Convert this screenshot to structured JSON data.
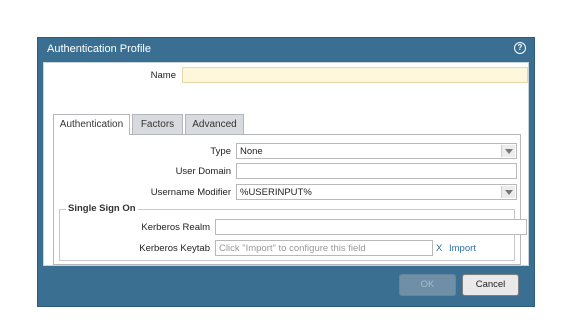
{
  "dialog": {
    "title": "Authentication Profile",
    "help_icon": "?"
  },
  "name_field": {
    "label": "Name",
    "value": ""
  },
  "tabs": [
    {
      "label": "Authentication",
      "active": true
    },
    {
      "label": "Factors",
      "active": false
    },
    {
      "label": "Advanced",
      "active": false
    }
  ],
  "authentication": {
    "type": {
      "label": "Type",
      "value": "None"
    },
    "user_domain": {
      "label": "User Domain",
      "value": ""
    },
    "username_modifier": {
      "label": "Username Modifier",
      "value": "%USERINPUT%"
    }
  },
  "sso": {
    "title": "Single Sign On",
    "kerberos_realm": {
      "label": "Kerberos Realm",
      "value": ""
    },
    "kerberos_keytab": {
      "label": "Kerberos Keytab",
      "placeholder": "Click \"Import\" to configure this field"
    },
    "clear_label": "X",
    "import_label": "Import"
  },
  "buttons": {
    "ok": "OK",
    "cancel": "Cancel"
  },
  "colors": {
    "header": "#3b6f92",
    "name_bg": "#fff7dc",
    "link": "#2e6da4"
  }
}
